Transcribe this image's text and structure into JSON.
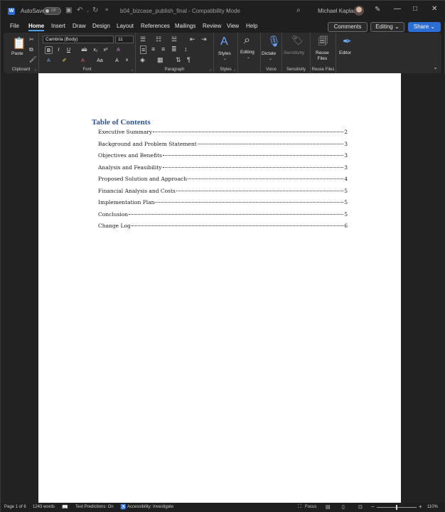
{
  "titlebar": {
    "autosave_label": "AutoSave",
    "autosave_state": "Off",
    "document_title": "b04_bizcase_publish_final  -  Compatibility Mode",
    "title_chevron": "⌄",
    "user_name": "Michael Kaplan",
    "window_buttons": [
      "—",
      "□",
      "✕"
    ]
  },
  "tabs": [
    "File",
    "Home",
    "Insert",
    "Draw",
    "Design",
    "Layout",
    "References",
    "Mailings",
    "Review",
    "View",
    "Help"
  ],
  "active_tab": "Home",
  "header_buttons": {
    "comments": "Comments",
    "editing": "Editing ⌄",
    "share": "Share ⌄"
  },
  "ribbon": {
    "clipboard": {
      "paste": "Paste",
      "group_label": "Clipboard"
    },
    "font": {
      "font_name": "Cambria (Body)",
      "font_size": "11",
      "group_label": "Font"
    },
    "paragraph": {
      "group_label": "Paragraph"
    },
    "styles": {
      "label": "Styles",
      "group_label": "Styles"
    },
    "editing": {
      "label": "Editing"
    },
    "voice": {
      "label": "Dictate",
      "group_label": "Voice"
    },
    "sensitivity": {
      "label": "Sensitivity",
      "group_label": "Sensitivity"
    },
    "reuse": {
      "label": "Reuse\nFiles",
      "group_label": "Reuse Files"
    },
    "editor": {
      "label": "Editor"
    }
  },
  "document": {
    "toc_title": "Table of Contents",
    "toc": [
      {
        "title": "Executive Summary",
        "page": "2"
      },
      {
        "title": "Background and Problem Statement",
        "page": "3"
      },
      {
        "title": "Objectives and Benefits",
        "page": "3"
      },
      {
        "title": "Analysis and Feasibility",
        "page": "3"
      },
      {
        "title": "Proposed Solution and Approach",
        "page": "4"
      },
      {
        "title": "Financial Analysis and Costs",
        "page": "5"
      },
      {
        "title": "Implementation Plan",
        "page": "5"
      },
      {
        "title": "Conclusion",
        "page": "5"
      },
      {
        "title": "Change Log",
        "page": "6"
      }
    ]
  },
  "statusbar": {
    "page": "Page 1 of 6",
    "words": "1243 words",
    "text_predictions": "Text Predictions: On",
    "accessibility": "Accessibility: Investigate",
    "focus": "Focus",
    "zoom": "110%",
    "zoom_minus": "−",
    "zoom_plus": "+"
  },
  "colors": {
    "accent": "#2b6ed6",
    "toc_title": "#2e5597",
    "background": "#1f1f1f"
  }
}
